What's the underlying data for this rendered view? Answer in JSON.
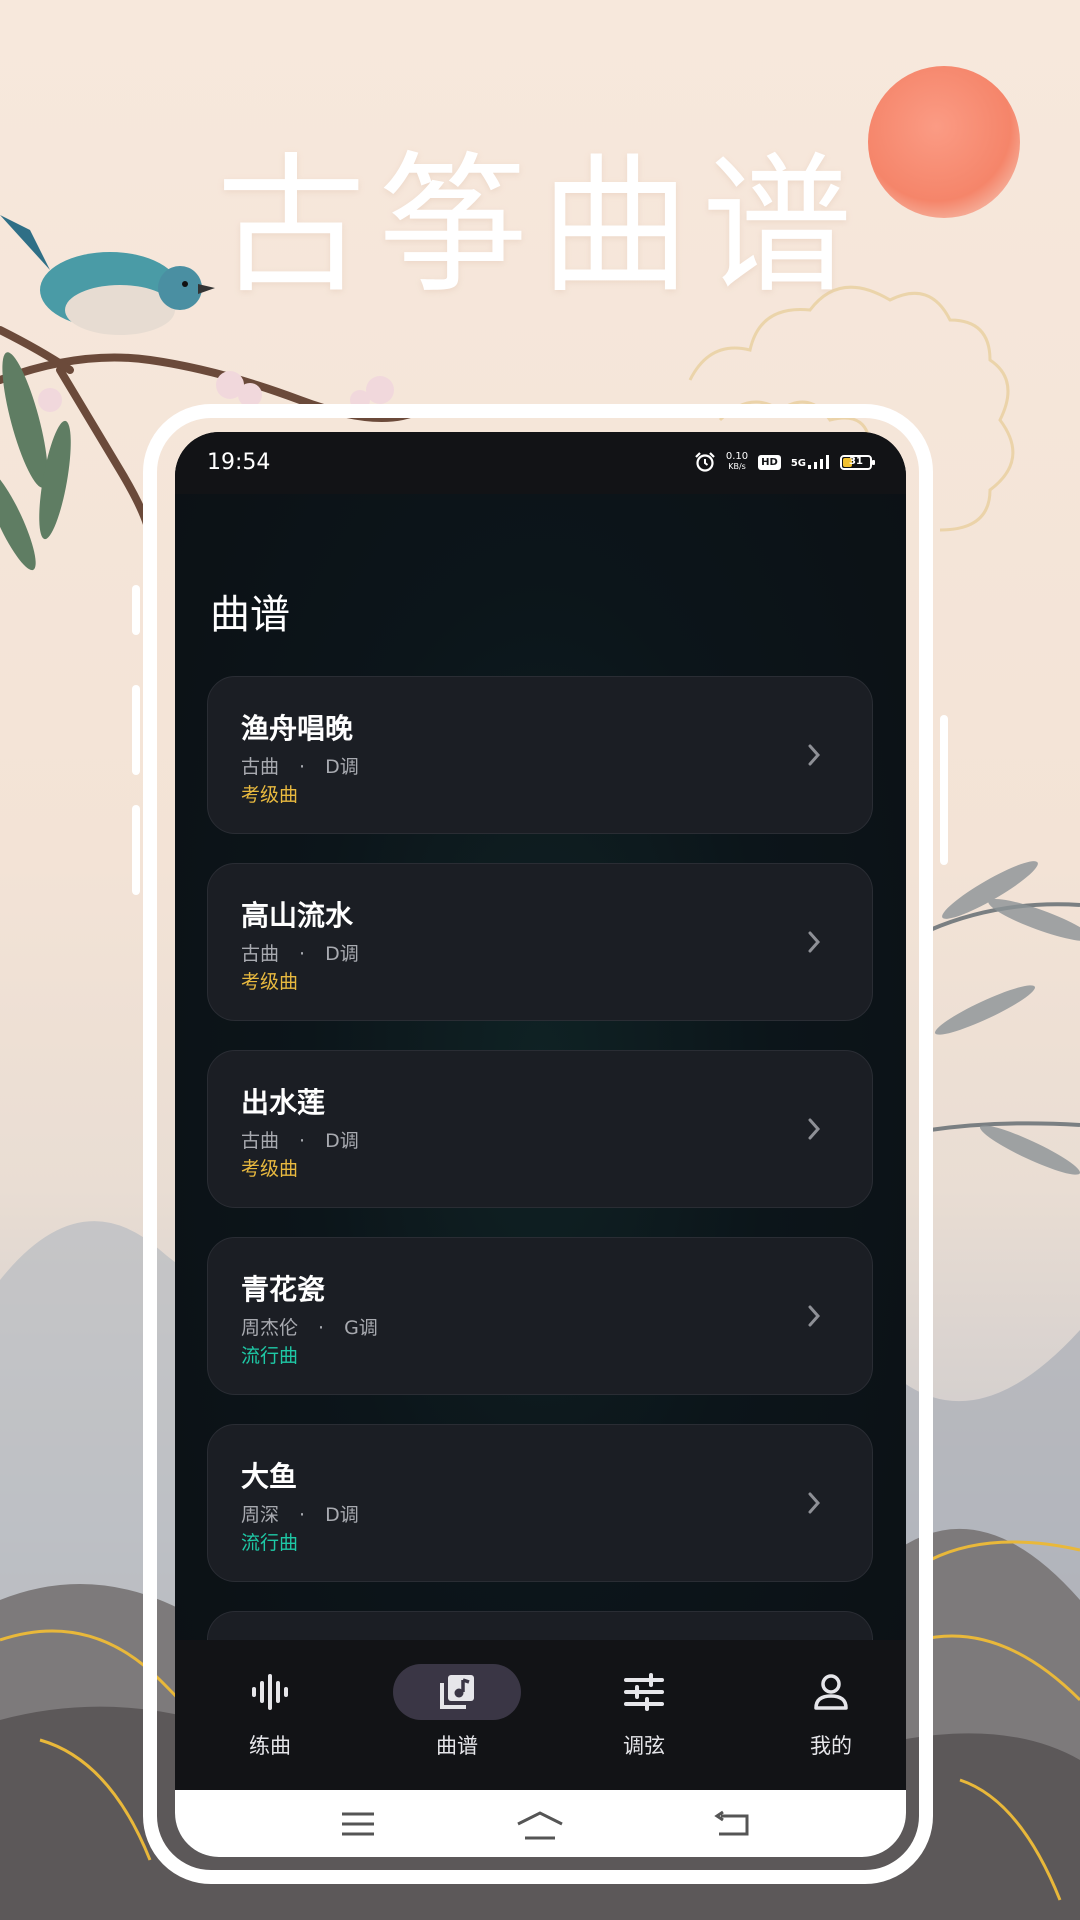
{
  "promo": {
    "title": "古筝曲谱"
  },
  "status_bar": {
    "time": "19:54",
    "net_speed": "0.10",
    "net_unit": "KB/s",
    "hd": "HD",
    "network": "5G",
    "battery": "31"
  },
  "page": {
    "title": "曲谱"
  },
  "songs": [
    {
      "title": "渔舟唱晚",
      "artist": "古曲",
      "dot": "·",
      "key": "D调",
      "tag": "考级曲",
      "tag_color": "#e8b93f"
    },
    {
      "title": "高山流水",
      "artist": "古曲",
      "dot": "·",
      "key": "D调",
      "tag": "考级曲",
      "tag_color": "#e8b93f"
    },
    {
      "title": "出水莲",
      "artist": "古曲",
      "dot": "·",
      "key": "D调",
      "tag": "考级曲",
      "tag_color": "#e8b93f"
    },
    {
      "title": "青花瓷",
      "artist": "周杰伦",
      "dot": "·",
      "key": "G调",
      "tag": "流行曲",
      "tag_color": "#1ec9a6"
    },
    {
      "title": "大鱼",
      "artist": "周深",
      "dot": "·",
      "key": "D调",
      "tag": "流行曲",
      "tag_color": "#1ec9a6"
    }
  ],
  "tabs": [
    {
      "label": "练曲",
      "icon": "waveform-icon",
      "active": false
    },
    {
      "label": "曲谱",
      "icon": "music-library-icon",
      "active": true
    },
    {
      "label": "调弦",
      "icon": "tune-sliders-icon",
      "active": false
    },
    {
      "label": "我的",
      "icon": "person-icon",
      "active": false
    }
  ],
  "nav_bar": {
    "buttons": [
      "menu-icon",
      "home-icon",
      "back-icon"
    ]
  },
  "colors": {
    "tab_active_bg": "#3a3645",
    "card_bg": "#1b1e24",
    "exam_tag": "#e8b93f",
    "pop_tag": "#1ec9a6"
  }
}
